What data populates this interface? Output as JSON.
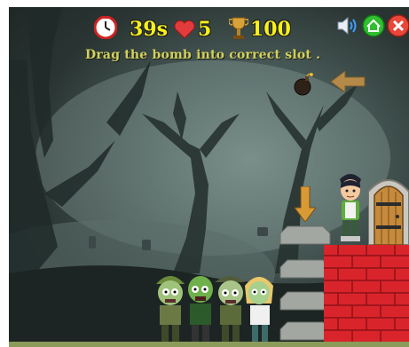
{
  "hud": {
    "time": "39s",
    "lives": "5",
    "score": "100"
  },
  "instruction": "Drag the bomb  into correct slot .",
  "icons": {
    "timer": "clock-icon",
    "lives": "heart-icon",
    "score": "trophy-icon",
    "sound": "speaker-icon",
    "home": "home-icon",
    "close": "close-icon",
    "bomb": "bomb-icon",
    "hint_arrow": "arrow-left-icon",
    "slot_arrow": "arrow-down-icon"
  },
  "colors": {
    "hud_text": "#f7f01a",
    "instruction_text": "#d2d15a",
    "home_button": "#2fbf2f",
    "close_button": "#e8473a",
    "tower_brick": "#d9242b"
  }
}
